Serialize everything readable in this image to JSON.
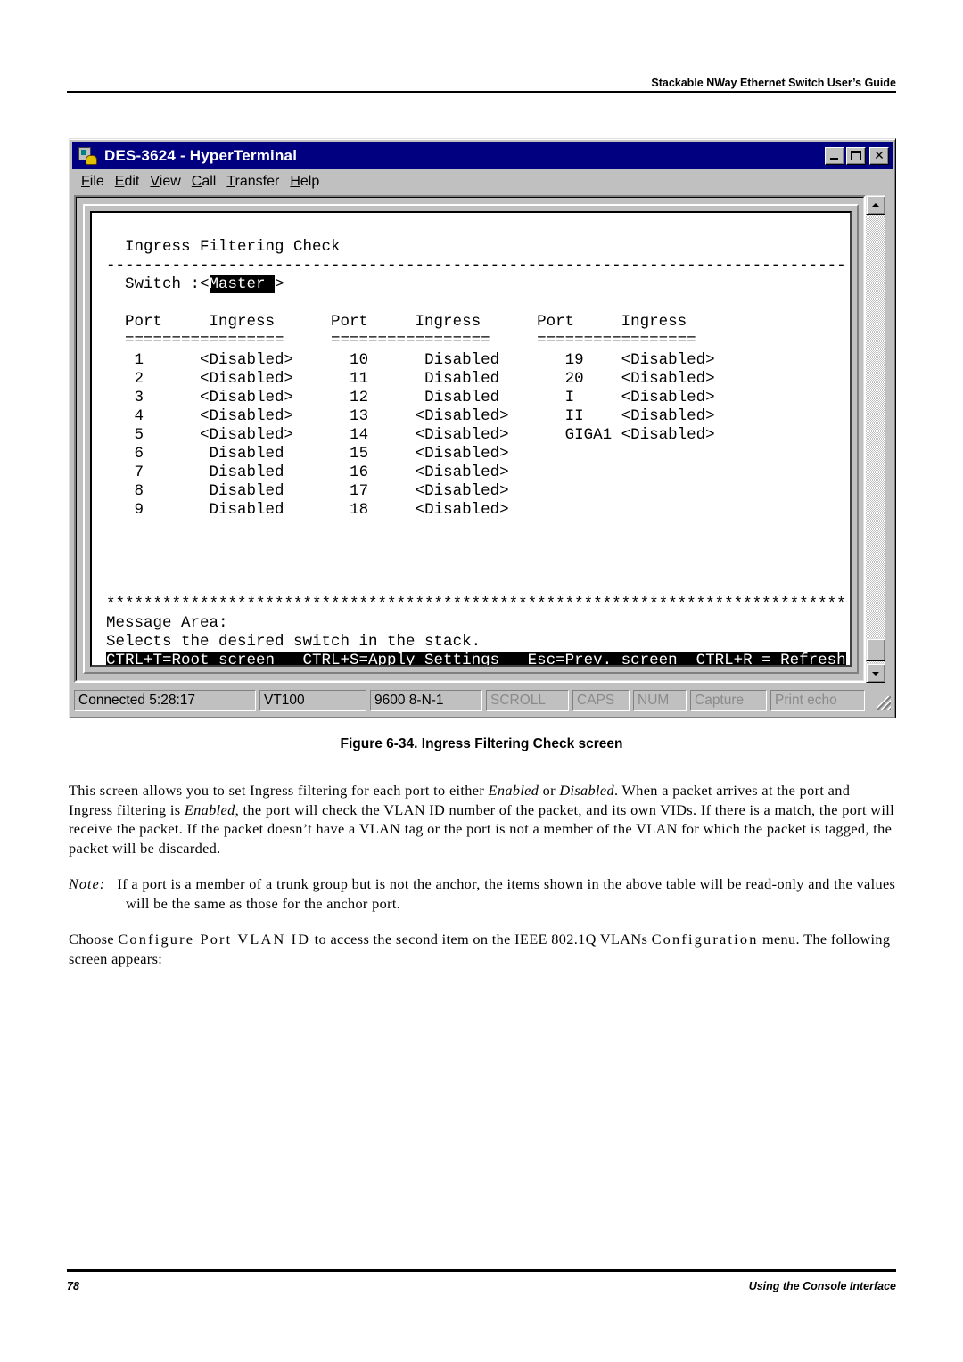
{
  "page_header": "Stackable NWay Ethernet Switch User’s Guide",
  "window": {
    "title": "DES-3624 - HyperTerminal",
    "controls": {
      "minimize": "minimize",
      "maximize": "maximize",
      "close": "close"
    },
    "menu": [
      {
        "label": "File",
        "mnemonic": "F"
      },
      {
        "label": "Edit",
        "mnemonic": "E"
      },
      {
        "label": "View",
        "mnemonic": "V"
      },
      {
        "label": "Call",
        "mnemonic": "C"
      },
      {
        "label": "Transfer",
        "mnemonic": "T"
      },
      {
        "label": "Help",
        "mnemonic": "H"
      }
    ],
    "status_bar": {
      "connected": "Connected 5:28:17",
      "emulation": "VT100",
      "settings": "9600 8-N-1",
      "scroll": "SCROLL",
      "caps": "CAPS",
      "num": "NUM",
      "capture": "Capture",
      "print_echo": "Print echo"
    }
  },
  "terminal": {
    "screen_title": "Ingress Filtering Check",
    "divider": "-------------------------------------------------------------------------------",
    "switch_label": "Switch :",
    "switch_value": "Master",
    "column_headers": {
      "port": "Port",
      "ingress": "Ingress"
    },
    "header_underline": "=================",
    "columns": [
      [
        {
          "port": "1",
          "ingress": "<Disabled>"
        },
        {
          "port": "2",
          "ingress": "<Disabled>"
        },
        {
          "port": "3",
          "ingress": "<Disabled>"
        },
        {
          "port": "4",
          "ingress": "<Disabled>"
        },
        {
          "port": "5",
          "ingress": "<Disabled>"
        },
        {
          "port": "6",
          "ingress": "Disabled"
        },
        {
          "port": "7",
          "ingress": "Disabled"
        },
        {
          "port": "8",
          "ingress": "Disabled"
        },
        {
          "port": "9",
          "ingress": "Disabled"
        }
      ],
      [
        {
          "port": "10",
          "ingress": "Disabled"
        },
        {
          "port": "11",
          "ingress": "Disabled"
        },
        {
          "port": "12",
          "ingress": "Disabled"
        },
        {
          "port": "13",
          "ingress": "<Disabled>"
        },
        {
          "port": "14",
          "ingress": "<Disabled>"
        },
        {
          "port": "15",
          "ingress": "<Disabled>"
        },
        {
          "port": "16",
          "ingress": "<Disabled>"
        },
        {
          "port": "17",
          "ingress": "<Disabled>"
        },
        {
          "port": "18",
          "ingress": "<Disabled>"
        }
      ],
      [
        {
          "port": "19",
          "ingress": "<Disabled>"
        },
        {
          "port": "20",
          "ingress": "<Disabled>"
        },
        {
          "port": "I",
          "ingress": "<Disabled>"
        },
        {
          "port": "II",
          "ingress": "<Disabled>"
        },
        {
          "port": "GIGA1",
          "ingress": "<Disabled>"
        }
      ]
    ],
    "stars": "*******************************************************************************",
    "message_area_label": "Message Area:",
    "message": "Selects the desired switch in the stack.",
    "hotkeys": "CTRL+T=Root screen   CTRL+S=Apply Settings   Esc=Prev. screen  CTRL+R = Refresh"
  },
  "figure_caption": "Figure 6-34.  Ingress Filtering Check screen",
  "body": {
    "p1": {
      "a": "This screen allows you to set Ingress filtering for each port to either ",
      "b": "Enabled",
      "c": " or ",
      "d": "Disabled",
      "e": ". When a packet arrives at the port and Ingress filtering is ",
      "f": "Enabled",
      "g": ", the port will check the VLAN ID number of the packet, and its own VIDs. If there is a match, the port will receive the packet. If the packet doesn’t have a VLAN tag or the port is not a member of the VLAN for which the packet is tagged, the packet will be discarded."
    },
    "note_label": "Note:",
    "note_text": "If a port is a member of a trunk group but is not the anchor, the items shown in the above table will be read-only and the values will be the same as those for the anchor port.",
    "p3": {
      "a": "Choose ",
      "b": "Configure Port VLAN ID",
      "c": " to access the second item on the IEEE 802.1Q VLANs ",
      "d": "Configuration",
      "e": " menu. The following screen appears:"
    }
  },
  "footer": {
    "page_number": "78",
    "section": "Using the Console Interface"
  }
}
